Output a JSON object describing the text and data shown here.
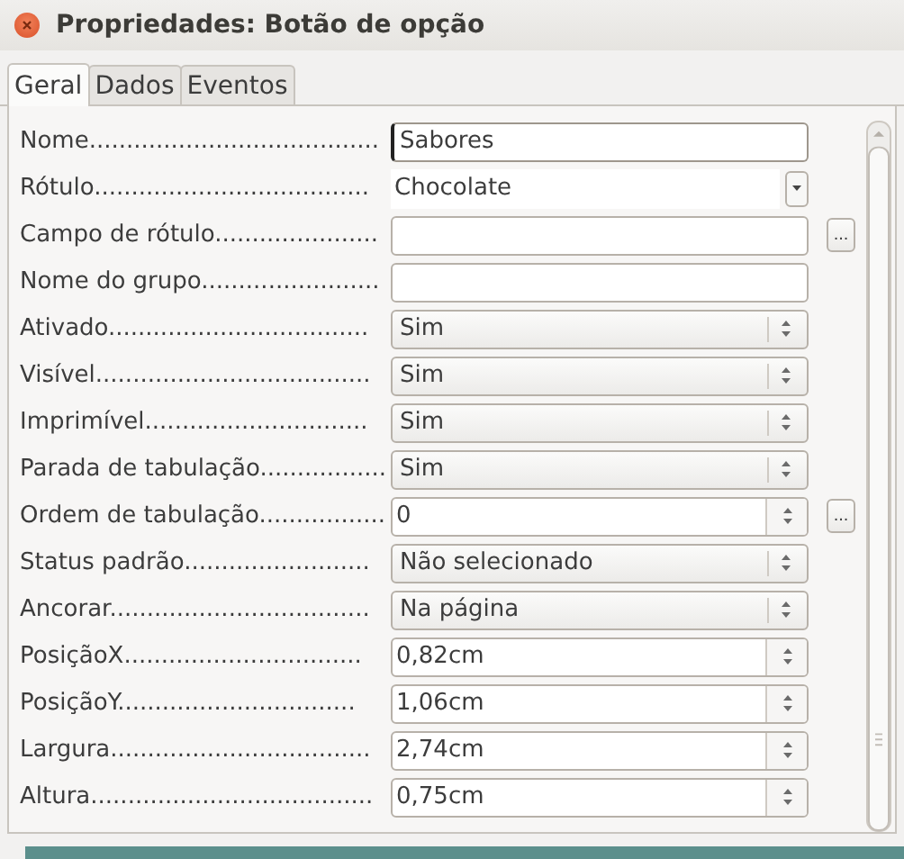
{
  "window": {
    "title": "Propriedades: Botão de opção"
  },
  "tabs": [
    {
      "label": "Geral",
      "selected": true
    },
    {
      "label": "Dados",
      "selected": false
    },
    {
      "label": "Eventos",
      "selected": false
    }
  ],
  "properties": [
    {
      "label": "Nome.......................................",
      "kind": "text",
      "value": "Sabores"
    },
    {
      "label": "Rótulo.....................................",
      "kind": "dropdown",
      "value": "Chocolate"
    },
    {
      "label": "Campo de rótulo......................",
      "kind": "text",
      "button": "..."
    },
    {
      "label": "Nome do grupo........................",
      "kind": "text"
    },
    {
      "label": "Ativado...................................",
      "kind": "select",
      "value": "Sim"
    },
    {
      "label": "Visível.....................................",
      "kind": "select",
      "value": "Sim"
    },
    {
      "label": "Imprimível..............................",
      "kind": "select",
      "value": "Sim"
    },
    {
      "label": "Parada de tabulação.................",
      "kind": "select",
      "value": "Sim"
    },
    {
      "label": "Ordem de tabulação.................",
      "kind": "spin",
      "value": "0",
      "button": "..."
    },
    {
      "label": "Status padrão.........................",
      "kind": "select",
      "value": "Não selecionado"
    },
    {
      "label": "Ancorar...................................",
      "kind": "select",
      "value": "Na página"
    },
    {
      "label": "PosiçãoX................................",
      "kind": "spin",
      "value": "0,82cm"
    },
    {
      "label": "PosiçãoY................................",
      "kind": "spin",
      "value": "1,06cm"
    },
    {
      "label": "Largura...................................",
      "kind": "spin",
      "value": "2,74cm"
    },
    {
      "label": "Altura......................................",
      "kind": "spin",
      "value": "0,75cm"
    }
  ]
}
